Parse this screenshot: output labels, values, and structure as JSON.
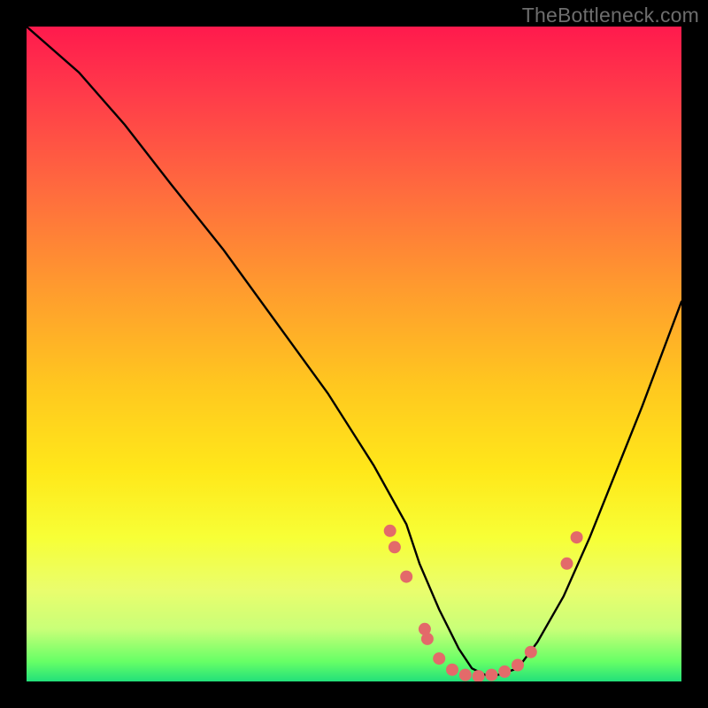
{
  "watermark": "TheBottleneck.com",
  "chart_data": {
    "type": "line",
    "title": "",
    "xlabel": "",
    "ylabel": "",
    "xlim": [
      0,
      100
    ],
    "ylim": [
      0,
      100
    ],
    "series": [
      {
        "name": "curve",
        "x": [
          0,
          8,
          15,
          22,
          30,
          38,
          46,
          53,
          58,
          60,
          63,
          66,
          68,
          70,
          72,
          75,
          78,
          82,
          86,
          90,
          94,
          100
        ],
        "y": [
          100,
          93,
          85,
          76,
          66,
          55,
          44,
          33,
          24,
          18,
          11,
          5,
          2,
          1,
          1,
          2,
          6,
          13,
          22,
          32,
          42,
          58
        ]
      }
    ],
    "markers": [
      {
        "x": 55.5,
        "y": 23.0
      },
      {
        "x": 56.2,
        "y": 20.5
      },
      {
        "x": 58.0,
        "y": 16.0
      },
      {
        "x": 60.8,
        "y": 8.0
      },
      {
        "x": 61.2,
        "y": 6.5
      },
      {
        "x": 63.0,
        "y": 3.5
      },
      {
        "x": 65.0,
        "y": 1.8
      },
      {
        "x": 67.0,
        "y": 1.0
      },
      {
        "x": 69.0,
        "y": 0.8
      },
      {
        "x": 71.0,
        "y": 1.0
      },
      {
        "x": 73.0,
        "y": 1.5
      },
      {
        "x": 75.0,
        "y": 2.5
      },
      {
        "x": 77.0,
        "y": 4.5
      },
      {
        "x": 82.5,
        "y": 18.0
      },
      {
        "x": 84.0,
        "y": 22.0
      }
    ],
    "gradient_stops": [
      {
        "pos": 0.0,
        "color": "#ff1a4d"
      },
      {
        "pos": 0.25,
        "color": "#ff6b3e"
      },
      {
        "pos": 0.55,
        "color": "#ffc81f"
      },
      {
        "pos": 0.78,
        "color": "#eafd6d"
      },
      {
        "pos": 1.0,
        "color": "#22e07a"
      }
    ],
    "marker_color": "#e36a6a",
    "curve_color": "#000000"
  }
}
